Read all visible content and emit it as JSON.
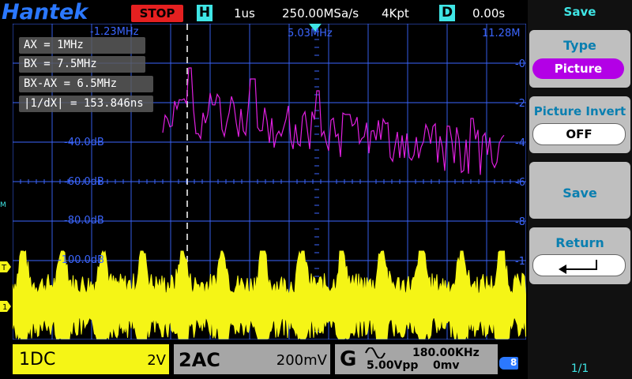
{
  "header": {
    "brand": "Hantek",
    "status": "STOP",
    "h_label": "H",
    "timebase": "1us",
    "sample_rate": "250.00MSa/s",
    "mem_depth": "4Kpt",
    "d_label": "D",
    "delay": "0.00s"
  },
  "fft": {
    "freq_left": "-1.23MHz",
    "freq_center": "5.03MHz",
    "freq_right": "11.28M",
    "db_labels": [
      "-40.0dB",
      "-60.0dB",
      "-80.0dB",
      "-100.0dB"
    ],
    "right_labels": [
      "-0",
      "-2",
      "-4",
      "-6",
      "-8",
      "-1"
    ]
  },
  "cursors": {
    "ax": "AX     = 1MHz",
    "bx": "BX     = 7.5MHz",
    "diff": "BX-AX = 6.5MHz",
    "inv": "|1/dX|   = 153.846ns"
  },
  "markers": {
    "m_label": "M",
    "trig_label": "T",
    "ch1_label": "1"
  },
  "channels": {
    "ch1_name": "1DC",
    "ch1_scale": "2V",
    "ch2_name": "2AC",
    "ch2_scale": "200mV",
    "gen_name": "G",
    "gen_freq": "180.00KHz",
    "gen_amp": "5.00Vpp",
    "gen_offset": "0mv",
    "batt_label": "8"
  },
  "menu": {
    "title": "Save",
    "type_label": "Type",
    "type_value": "Picture",
    "invert_label": "Picture Invert",
    "invert_value": "OFF",
    "save_label": "Save",
    "return_label": "Return",
    "page": "1/1"
  },
  "colors": {
    "ch1": "#f5f516",
    "fft": "#e020e0",
    "accent": "#3fe5e5",
    "grid": "#3b66ff",
    "stop": "#e52020"
  }
}
